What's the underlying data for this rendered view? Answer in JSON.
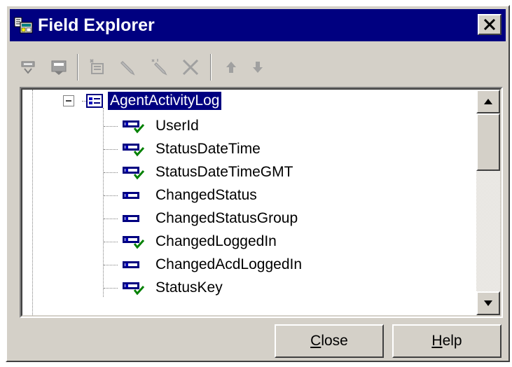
{
  "window": {
    "title": "Field Explorer",
    "close_glyph": "×",
    "colors": {
      "titlebar": "#000080",
      "face": "#d4d0c8",
      "selection": "#000080"
    }
  },
  "toolbar": {
    "buttons": [
      {
        "name": "insert-field",
        "icon": "field-insert-icon",
        "enabled": true
      },
      {
        "name": "insert-group",
        "icon": "group-insert-icon",
        "enabled": true
      },
      {
        "name": "new",
        "icon": "new-field-icon",
        "enabled": false
      },
      {
        "name": "edit",
        "icon": "pencil-icon",
        "enabled": false
      },
      {
        "name": "rename",
        "icon": "rename-icon",
        "enabled": false
      },
      {
        "name": "delete",
        "icon": "delete-x-icon",
        "enabled": false
      },
      {
        "name": "move-up",
        "icon": "arrow-up-icon",
        "enabled": false
      },
      {
        "name": "move-down",
        "icon": "arrow-down-icon",
        "enabled": false
      }
    ]
  },
  "tree": {
    "root": {
      "label": "AgentActivityLog",
      "expanded": true,
      "selected": true,
      "icon": "table-icon"
    },
    "fields": [
      {
        "label": "UserId",
        "used": true
      },
      {
        "label": "StatusDateTime",
        "used": true
      },
      {
        "label": "StatusDateTimeGMT",
        "used": true
      },
      {
        "label": "ChangedStatus",
        "used": false
      },
      {
        "label": "ChangedStatusGroup",
        "used": false
      },
      {
        "label": "ChangedLoggedIn",
        "used": true
      },
      {
        "label": "ChangedAcdLoggedIn",
        "used": false
      },
      {
        "label": "StatusKey",
        "used": true
      }
    ]
  },
  "buttons": {
    "close": "Close",
    "help": "Help"
  }
}
